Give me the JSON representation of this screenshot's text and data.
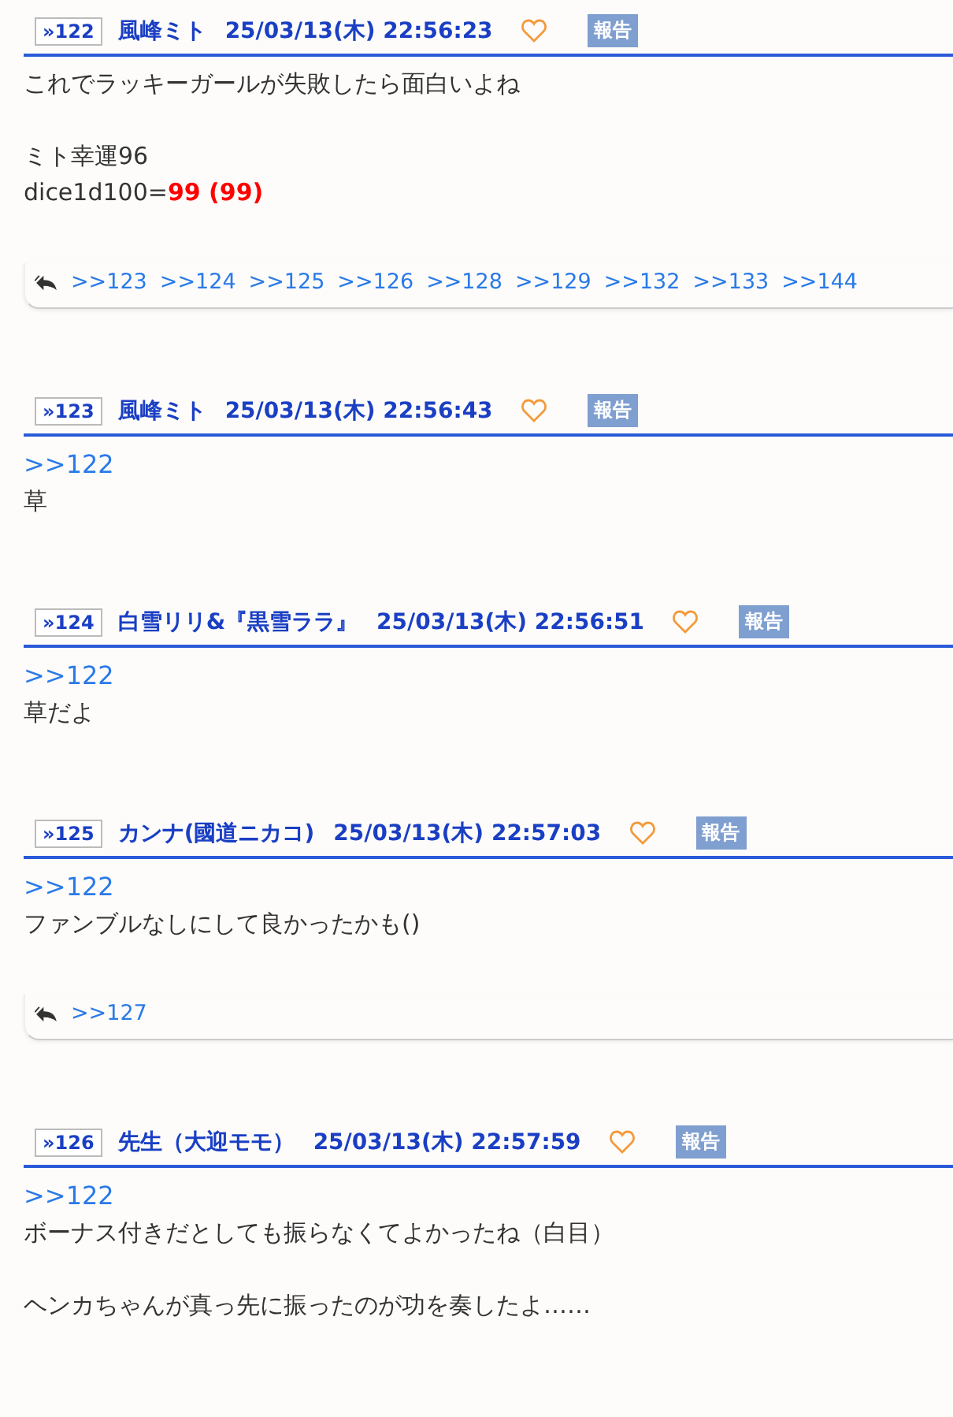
{
  "posts": [
    {
      "number": "»122",
      "name": "風峰ミト",
      "date": "25/03/13(木) 22:56:23",
      "report": "報告",
      "liked": false,
      "lines": [
        {
          "kind": "text",
          "text": "これでラッキーガールが失敗したら面白いよね"
        },
        {
          "kind": "blank"
        },
        {
          "kind": "text",
          "text": "ミト幸運96"
        },
        {
          "kind": "dice",
          "text": "dice1d100=",
          "result": "99 (99)"
        }
      ],
      "replies": [
        ">>123",
        ">>124",
        ">>125",
        ">>126",
        ">>128",
        ">>129",
        ">>132",
        ">>133",
        ">>144"
      ]
    },
    {
      "number": "»123",
      "name": "風峰ミト",
      "date": "25/03/13(木) 22:56:43",
      "report": "報告",
      "liked": false,
      "lines": [
        {
          "kind": "anchor",
          "text": ">>122"
        },
        {
          "kind": "text",
          "text": "草"
        }
      ]
    },
    {
      "number": "»124",
      "name": "白雪リリ&『黒雪ララ』",
      "date": "25/03/13(木) 22:56:51",
      "report": "報告",
      "liked": false,
      "lines": [
        {
          "kind": "anchor",
          "text": ">>122"
        },
        {
          "kind": "text",
          "text": "草だよ"
        }
      ]
    },
    {
      "number": "»125",
      "name": "カンナ(國道ニカコ)",
      "date": "25/03/13(木) 22:57:03",
      "report": "報告",
      "liked": false,
      "lines": [
        {
          "kind": "anchor",
          "text": ">>122"
        },
        {
          "kind": "text",
          "text": "ファンブルなしにして良かったかも()"
        }
      ],
      "replies": [
        ">>127"
      ]
    },
    {
      "number": "»126",
      "name": "先生（大迎モモ）",
      "date": "25/03/13(木) 22:57:59",
      "report": "報告",
      "liked": false,
      "lines": [
        {
          "kind": "anchor",
          "text": ">>122"
        },
        {
          "kind": "text",
          "text": "ボーナス付きだとしても振らなくてよかったね（白目）"
        },
        {
          "kind": "blank"
        },
        {
          "kind": "text",
          "text": "ヘンカちゃんが真っ先に振ったのが功を奏したよ……"
        }
      ]
    }
  ]
}
